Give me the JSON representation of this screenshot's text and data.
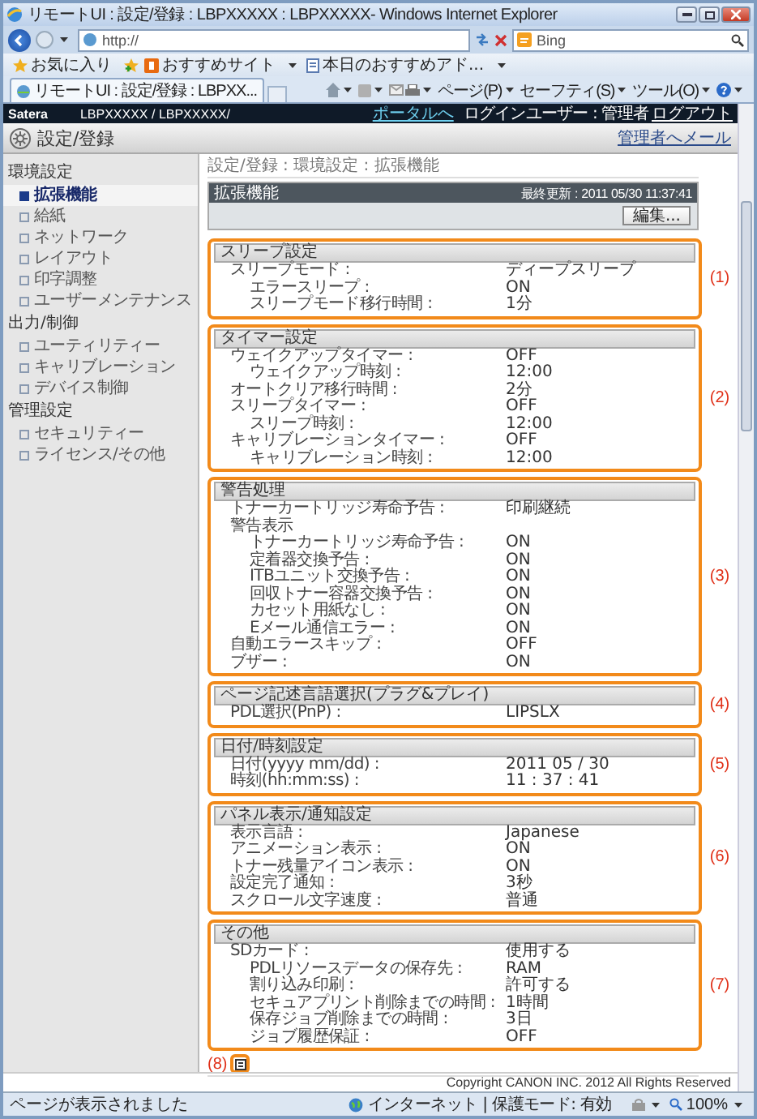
{
  "window": {
    "title": "リモートUI : 設定/登録 : LBPXXXXX : LBPXXXXX- Windows Internet Explorer"
  },
  "address_bar": {
    "url": "http://",
    "search_engine": "Bing"
  },
  "favorites_bar": {
    "favorites": "お気に入り",
    "links": [
      "おすすめサイト",
      "本日のおすすめアド..."
    ]
  },
  "tab": {
    "title": "リモートUI : 設定/登録 : LBPXX..."
  },
  "command_bar": [
    "ページ(P)",
    "セーフティ(S)",
    "ツール(O)"
  ],
  "page_header": {
    "brand": "Satera",
    "device": "LBPXXXXX / LBPXXXXX/",
    "portal_link": "ポータルへ",
    "login_user": "ログインユーザー : 管理者",
    "logout_link": "ログアウト"
  },
  "page_title": {
    "title": "設定/登録",
    "mail_link": "管理者へメール"
  },
  "sidebar": {
    "groups": [
      {
        "label": "環境設定",
        "items": [
          {
            "label": "拡張機能",
            "selected": true
          },
          {
            "label": "給紙",
            "selected": false
          },
          {
            "label": "ネットワーク",
            "selected": false
          },
          {
            "label": "レイアウト",
            "selected": false
          },
          {
            "label": "印字調整",
            "selected": false
          },
          {
            "label": "ユーザーメンテナンス",
            "selected": false
          }
        ]
      },
      {
        "label": "出力/制御",
        "items": [
          {
            "label": "ユーティリティー",
            "selected": false
          },
          {
            "label": "キャリブレーション",
            "selected": false
          },
          {
            "label": "デバイス制御",
            "selected": false
          }
        ]
      },
      {
        "label": "管理設定",
        "items": [
          {
            "label": "セキュリティー",
            "selected": false
          },
          {
            "label": "ライセンス/その他",
            "selected": false
          }
        ]
      }
    ]
  },
  "breadcrumb": "設定/登録 : 環境設定 : 拡張機能",
  "panel": {
    "title": "拡張機能",
    "last_updated": "最終更新 : 2011 05/30 11:37:41",
    "edit_button": "編集..."
  },
  "sections": [
    {
      "title": "スリープ設定",
      "callout": "(1)",
      "rows": [
        {
          "label": "スリープモード :",
          "value": "ディープスリープ",
          "children": [
            {
              "label": "エラースリープ :",
              "value": "ON"
            },
            {
              "label": "スリープモード移行時間 :",
              "value": "1分"
            }
          ]
        }
      ]
    },
    {
      "title": "タイマー設定",
      "callout": "(2)",
      "rows": [
        {
          "label": "ウェイクアップタイマー :",
          "value": "OFF",
          "children": [
            {
              "label": "ウェイクアップ時刻 :",
              "value": "12:00"
            }
          ]
        },
        {
          "label": "オートクリア移行時間 :",
          "value": "2分"
        },
        {
          "label": "スリープタイマー :",
          "value": "OFF",
          "children": [
            {
              "label": "スリープ時刻 :",
              "value": "12:00"
            }
          ]
        },
        {
          "label": "キャリブレーションタイマー :",
          "value": "OFF",
          "children": [
            {
              "label": "キャリブレーション時刻 :",
              "value": "12:00"
            }
          ]
        }
      ]
    },
    {
      "title": "警告処理",
      "callout": "(3)",
      "rows": [
        {
          "label": "トナーカートリッジ寿命予告 :",
          "value": "印刷継続"
        },
        {
          "label": "警告表示",
          "children": [
            {
              "label": "トナーカートリッジ寿命予告 :",
              "value": "ON"
            },
            {
              "label": "定着器交換予告 :",
              "value": "ON"
            },
            {
              "label": "ITBユニット交換予告 :",
              "value": "ON"
            },
            {
              "label": "回収トナー容器交換予告 :",
              "value": "ON"
            },
            {
              "label": "カセット用紙なし :",
              "value": "ON"
            },
            {
              "label": "Eメール通信エラー :",
              "value": "ON"
            }
          ]
        },
        {
          "label": "自動エラースキップ :",
          "value": "OFF"
        },
        {
          "label": "ブザー :",
          "value": "ON"
        }
      ]
    },
    {
      "title": "ページ記述言語選択(プラグ&プレイ)",
      "callout": "(4)",
      "rows": [
        {
          "label": "PDL選択(PnP) :",
          "value": "LIPSLX"
        }
      ]
    },
    {
      "title": "日付/時刻設定",
      "callout": "(5)",
      "rows": [
        {
          "label": "日付(yyyy mm/dd) :",
          "value": "2011 05 / 30"
        },
        {
          "label": "時刻(hh:mm:ss) :",
          "value": "11 : 37 : 41"
        }
      ]
    },
    {
      "title": "パネル表示/通知設定",
      "callout": "(6)",
      "rows": [
        {
          "label": "表示言語 :",
          "value": "Japanese"
        },
        {
          "label": "アニメーション表示 :",
          "value": "ON"
        },
        {
          "label": "トナー残量アイコン表示 :",
          "value": "ON"
        },
        {
          "label": "設定完了通知 :",
          "value": "3秒"
        },
        {
          "label": "スクロール文字速度 :",
          "value": "普通"
        }
      ]
    },
    {
      "title": "その他",
      "callout": "(7)",
      "rows": [
        {
          "label": "SDカード :",
          "value": "使用する",
          "children": [
            {
              "label": "PDLリソースデータの保存先 :",
              "value": "RAM"
            },
            {
              "label": "割り込み印刷 :",
              "value": "許可する"
            },
            {
              "label": "セキュアプリント削除までの時間 :",
              "value": "1時間"
            },
            {
              "label": "保存ジョブ削除までの時間 :",
              "value": "3日"
            },
            {
              "label": "ジョブ履歴保証 :",
              "value": "OFF"
            }
          ]
        }
      ]
    }
  ],
  "footer_callout": "(8)",
  "copyright": "Copyright CANON INC. 2012 All Rights Reserved",
  "status_bar": {
    "message": "ページが表示されました",
    "zone": "インターネット | 保護モード: 有効",
    "zoom": "100%"
  }
}
